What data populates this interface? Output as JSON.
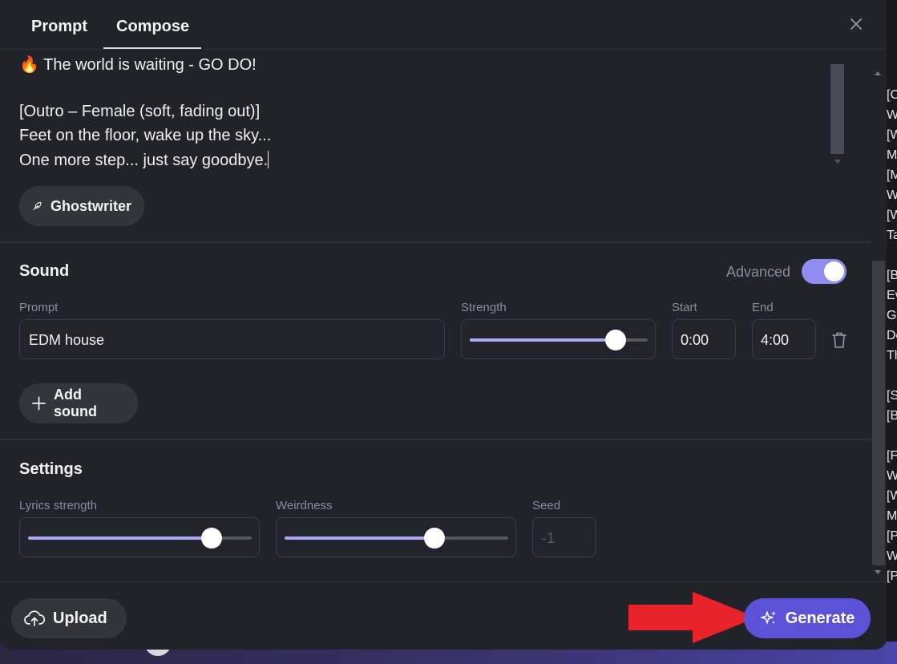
{
  "tabs": [
    {
      "label": "Prompt",
      "active": false
    },
    {
      "label": "Compose",
      "active": true
    }
  ],
  "close_icon": "close-icon",
  "lyrics": {
    "lines": [
      "🔥 The world is waiting - GO DO!",
      "",
      "[Outro – Female (soft, fading out)]",
      "Feet on the floor, wake up the sky...",
      "One more step... just say goodbye."
    ],
    "ghostwriter_label": "Ghostwriter",
    "ghostwriter_icon": "feather-icon"
  },
  "sound": {
    "title": "Sound",
    "advanced_label": "Advanced",
    "advanced_on": true,
    "prompt_label": "Prompt",
    "prompt_value": "EDM house",
    "strength_label": "Strength",
    "strength_value": 0.82,
    "start_label": "Start",
    "start_value": "0:00",
    "end_label": "End",
    "end_value": "4:00",
    "delete_icon": "trash-icon",
    "add_sound_label": "Add sound",
    "add_icon": "plus-icon"
  },
  "settings": {
    "title": "Settings",
    "lyrics_strength_label": "Lyrics strength",
    "lyrics_strength_value": 0.82,
    "weirdness_label": "Weirdness",
    "weirdness_value": 0.67,
    "seed_label": "Seed",
    "seed_placeholder": "-1"
  },
  "footer": {
    "upload_label": "Upload",
    "upload_icon": "cloud-upload-icon",
    "generate_label": "Generate",
    "generate_icon": "sparkles-icon",
    "annotation_arrow_color": "#e8232a"
  },
  "background_text": {
    "right_edge": [
      "[C",
      "W",
      "[W",
      "M",
      "[M",
      "W",
      "[W",
      "Ta",
      "",
      "[B",
      "Ev",
      "Go",
      "Do",
      "Th",
      "",
      "[S",
      "[B",
      "",
      "[F",
      "W",
      "[W",
      "M",
      "[P",
      "W",
      "[P"
    ]
  },
  "colors": {
    "accent": "#5b52d8",
    "slider": "#a9a8f0",
    "arrow": "#e8232a"
  }
}
